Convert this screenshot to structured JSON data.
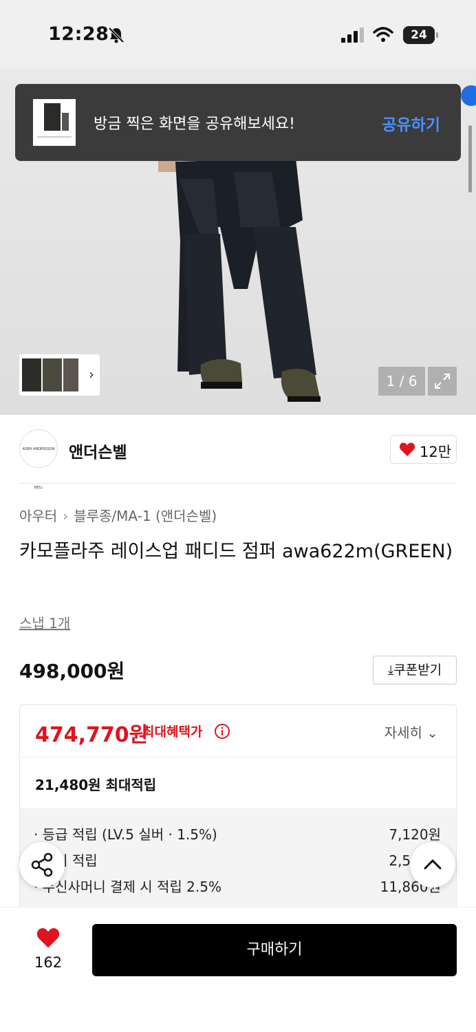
{
  "status_bar": {
    "time": "12:28",
    "battery": "24"
  },
  "toast": {
    "message": "방금 찍은 화면을 공유해보세요!",
    "action": "공유하기"
  },
  "gallery": {
    "counter": "1 / 6"
  },
  "brand": {
    "logo_text": "ADER ANDERSSON BELL",
    "name": "앤더슨벨",
    "likes": "12만"
  },
  "breadcrumb": {
    "category": "아우터",
    "subcategory": "블루종/MA-1 (앤더슨벨)"
  },
  "product": {
    "title": "카모플라주 레이스업 패디드 점퍼 awa622m(GREEN)",
    "snap": "스냅 1개",
    "price": "498,000원",
    "coupon": "쿠폰받기"
  },
  "benefit": {
    "max_price": "474,770원",
    "max_label": "최대혜택가",
    "detail": "자세히",
    "points_total": "21,480원 최대적립",
    "items": [
      {
        "label": "· 등급 적립 (LV.5 실버 · 1.5%)",
        "value": "7,120원"
      },
      {
        "label": "· 후기 적립",
        "value": "2,500원"
      },
      {
        "label": "· 무신사머니 결제 시 적립 2.5%",
        "value": "11,860원"
      }
    ]
  },
  "bottom": {
    "like_count": "162",
    "buy_label": "구매하기"
  },
  "colors": {
    "accent_red": "#e0141e",
    "toast_action": "#4a90ff",
    "buy_bg": "#000000"
  }
}
